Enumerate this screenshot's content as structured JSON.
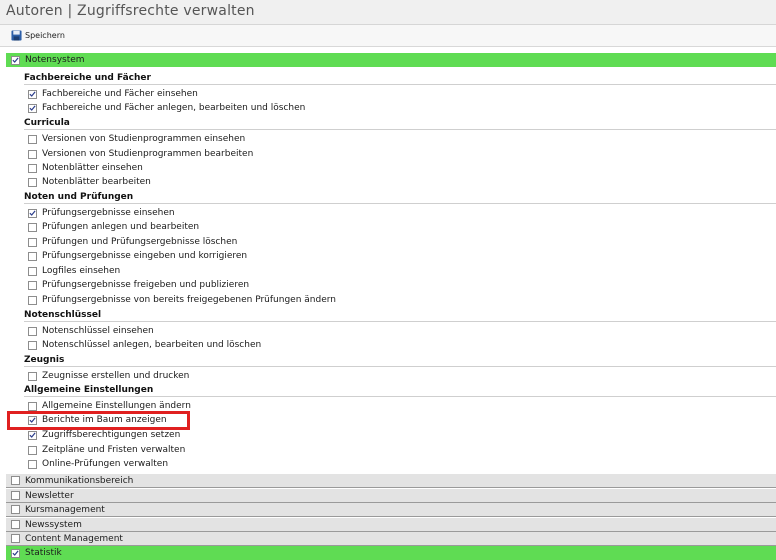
{
  "window": {
    "title": "Autoren | Zugriffsrechte verwalten"
  },
  "toolbar": {
    "save_label": "Speichern"
  },
  "colors": {
    "active_module": "#5fdc53",
    "inactive_module": "#e3e3e3",
    "highlight": "#e02020",
    "save_icon": "#2d5fa8"
  },
  "modules": {
    "notensystem": {
      "label": "Notensystem",
      "checked": true
    },
    "kommunikation": {
      "label": "Kommunikationsbereich",
      "checked": false
    },
    "newsletter": {
      "label": "Newsletter",
      "checked": false
    },
    "kursmanagement": {
      "label": "Kursmanagement",
      "checked": false
    },
    "newssystem": {
      "label": "Newssystem",
      "checked": false
    },
    "content": {
      "label": "Content Management",
      "checked": false
    },
    "statistik": {
      "label": "Statistik",
      "checked": true
    }
  },
  "groups": {
    "fachbereiche": {
      "title": "Fachbereiche und Fächer",
      "items": [
        {
          "label": "Fachbereiche und Fächer einsehen",
          "checked": true
        },
        {
          "label": "Fachbereiche und Fächer anlegen, bearbeiten und löschen",
          "checked": true
        }
      ]
    },
    "curricula": {
      "title": "Curricula",
      "items": [
        {
          "label": "Versionen von Studienprogrammen einsehen",
          "checked": false
        },
        {
          "label": "Versionen von Studienprogrammen bearbeiten",
          "checked": false
        },
        {
          "label": "Notenblätter einsehen",
          "checked": false
        },
        {
          "label": "Notenblätter bearbeiten",
          "checked": false
        }
      ]
    },
    "noten": {
      "title": "Noten und Prüfungen",
      "items": [
        {
          "label": "Prüfungsergebnisse einsehen",
          "checked": true
        },
        {
          "label": "Prüfungen anlegen und bearbeiten",
          "checked": false
        },
        {
          "label": "Prüfungen und Prüfungsergebnisse löschen",
          "checked": false
        },
        {
          "label": "Prüfungsergebnisse eingeben und korrigieren",
          "checked": false
        },
        {
          "label": "Logfiles einsehen",
          "checked": false
        },
        {
          "label": "Prüfungsergebnisse freigeben und publizieren",
          "checked": false
        },
        {
          "label": "Prüfungsergebnisse von bereits freigegebenen Prüfungen ändern",
          "checked": false
        }
      ]
    },
    "notenschluessel": {
      "title": "Notenschlüssel",
      "items": [
        {
          "label": "Notenschlüssel einsehen",
          "checked": false
        },
        {
          "label": "Notenschlüssel anlegen, bearbeiten und löschen",
          "checked": false
        }
      ]
    },
    "zeugnis": {
      "title": "Zeugnis",
      "items": [
        {
          "label": "Zeugnisse erstellen und drucken",
          "checked": false
        }
      ]
    },
    "allgemein": {
      "title": "Allgemeine Einstellungen",
      "items": [
        {
          "label": "Allgemeine Einstellungen ändern",
          "checked": false
        },
        {
          "label": "Berichte im Baum anzeigen",
          "checked": true
        },
        {
          "label": "Zugriffsberechtigungen setzen",
          "checked": true
        },
        {
          "label": "Zeitpläne und Fristen verwalten",
          "checked": false
        },
        {
          "label": "Online-Prüfungen verwalten",
          "checked": false
        }
      ]
    }
  }
}
